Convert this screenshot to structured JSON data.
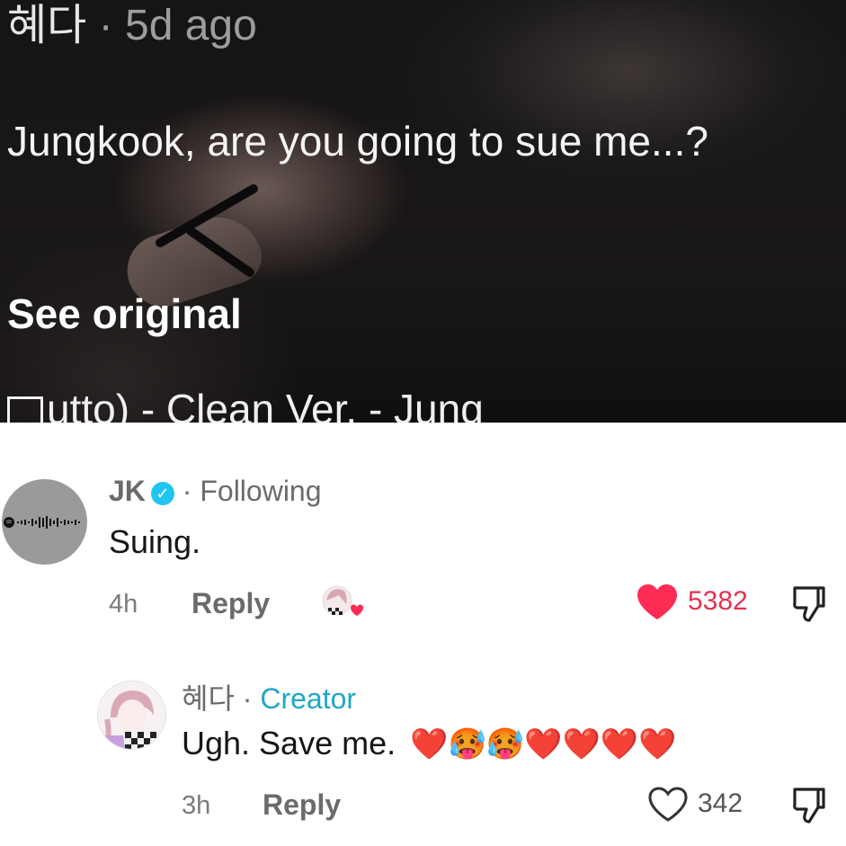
{
  "video": {
    "author": "혜다",
    "separator": "·",
    "time": "5d ago",
    "caption": "Jungkook, are you going to sue me...?",
    "see_original": "See original",
    "music": "utto) - Clean Ver. - Jung"
  },
  "comments": [
    {
      "name": "JK",
      "verified_icon": "verified-badge-icon",
      "separator": "·",
      "tag": "Following",
      "text": "Suing.",
      "time": "4h",
      "reply": "Reply",
      "likes": "5382",
      "liked": true,
      "heart_color": "#fe2c55"
    },
    {
      "name": "혜다",
      "separator": "·",
      "tag": "Creator",
      "text": "Ugh. Save me.",
      "emoji": "❤️🥵🥵❤️❤️❤️❤️",
      "time": "3h",
      "reply": "Reply",
      "likes": "342",
      "liked": false
    }
  ],
  "colors": {
    "accent_creator": "#1fa7c7",
    "verified": "#20c5f3",
    "like_red": "#fe2c55"
  }
}
